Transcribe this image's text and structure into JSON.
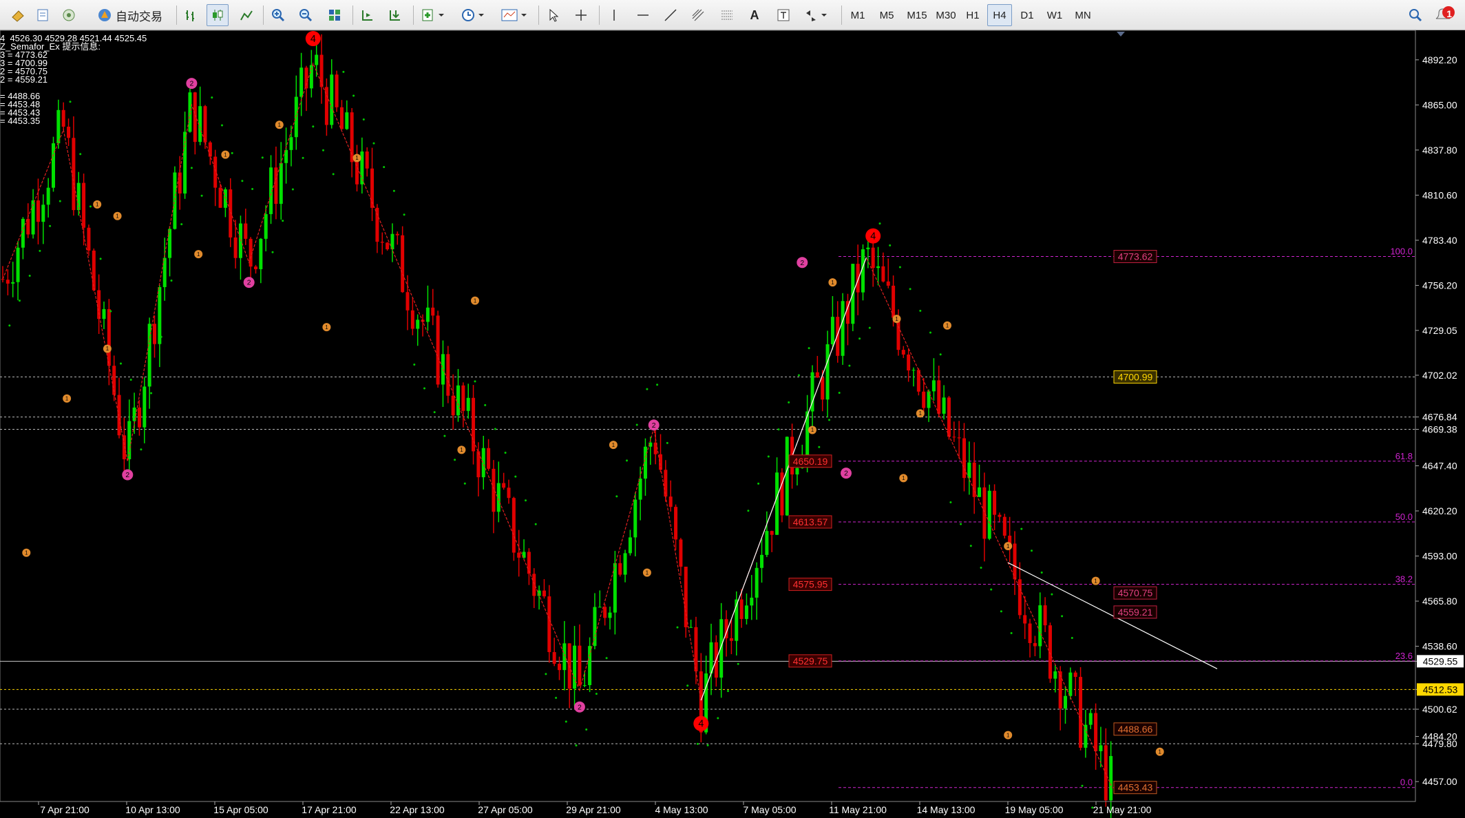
{
  "toolbar": {
    "auto_trade_label": "自动交易",
    "timeframes": [
      "M1",
      "M5",
      "M15",
      "M30",
      "H1",
      "H4",
      "D1",
      "W1",
      "MN"
    ],
    "active_timeframe": "H4",
    "notification_count": "1"
  },
  "info": {
    "ohlc": "4  4526.30 4529.28 4521.44 4525.45",
    "indicator_title": "Z_Semafor_Ex 提示信息:",
    "lines": [
      "3 = 4773.62",
      "3 = 4700.99",
      "2 = 4570.75",
      "2 = 4559.21",
      "",
      "= 4488.66",
      "= 4453.48",
      "= 4453.43",
      "= 4453.35"
    ]
  },
  "colors": {
    "bull": "#00e000",
    "bear": "#e00000",
    "grid": "#ffffff",
    "fib": "#d024d0",
    "semafor_small": "#e08a2c",
    "semafor_mid": "#e040a0",
    "semafor_big": "#ff0000",
    "current_price": "#ffffff",
    "highlight_price": "#ffd800"
  },
  "chart_data": {
    "type": "candlestick",
    "symbol_timeframe": "H4",
    "price_axis": [
      "4892.20",
      "4865.00",
      "4837.80",
      "4810.60",
      "4783.40",
      "4756.20",
      "4729.05",
      "4702.02",
      "4676.84",
      "4669.38",
      "4647.40",
      "4620.20",
      "4593.00",
      "4565.80",
      "4538.60",
      "4529.55",
      "4512.53",
      "4500.62",
      "4484.20",
      "4479.80",
      "4457.00"
    ],
    "ylim": [
      4445,
      4910
    ],
    "time_axis": [
      "7 Apr 21:00",
      "10 Apr 13:00",
      "15 Apr 05:00",
      "17 Apr 21:00",
      "22 Apr 13:00",
      "27 Apr 05:00",
      "29 Apr 21:00",
      "4 May 13:00",
      "7 May 05:00",
      "11 May 21:00",
      "14 May 13:00",
      "19 May 05:00",
      "21 May 21:00"
    ],
    "current_price": "4529.55",
    "highlight_price": "4512.53",
    "fib_levels": [
      {
        "label": "100.0",
        "price": 4773.62
      },
      {
        "label": "61.8",
        "price": 4650.19
      },
      {
        "label": "50.0",
        "price": 4613.57
      },
      {
        "label": "38.2",
        "price": 4575.95
      },
      {
        "label": "23.6",
        "price": 4529.75
      },
      {
        "label": "0.0",
        "price": 4453.43
      }
    ],
    "price_tags": [
      {
        "label": "4773.62",
        "price": 4773.62
      },
      {
        "label": "4700.99",
        "price": 4700.99
      },
      {
        "label": "4570.75",
        "price": 4570.75
      },
      {
        "label": "4559.21",
        "price": 4559.21
      },
      {
        "label": "4488.66",
        "price": 4488.66
      },
      {
        "label": "4453.43",
        "price": 4453.43
      }
    ],
    "fib_tags": [
      {
        "label": "4650.19",
        "price": 4650.19
      },
      {
        "label": "4613.57",
        "price": 4613.57
      },
      {
        "label": "4575.95",
        "price": 4575.95
      },
      {
        "label": "4529.75",
        "price": 4529.75
      }
    ],
    "h_lines": [
      4700.99,
      4676.84,
      4669.38,
      4529.55,
      4512.53,
      4500.62,
      4479.8
    ],
    "semafor_labels": {
      "small": "1",
      "mid": "2",
      "big": "4"
    },
    "zigzag": [
      {
        "t": 0,
        "p": 4760
      },
      {
        "t": 18,
        "p": 4850
      },
      {
        "t": 37,
        "p": 4650
      },
      {
        "t": 56,
        "p": 4865
      },
      {
        "t": 73,
        "p": 4770
      },
      {
        "t": 92,
        "p": 4890
      },
      {
        "t": 171,
        "p": 4512
      },
      {
        "t": 193,
        "p": 4670
      },
      {
        "t": 207,
        "p": 4506
      },
      {
        "t": 256,
        "p": 4773
      },
      {
        "t": 329,
        "p": 4453
      }
    ],
    "semafor_points": [
      {
        "t": 92,
        "p": 4905,
        "k": "big"
      },
      {
        "t": 258,
        "p": 4786,
        "k": "big"
      },
      {
        "t": 207,
        "p": 4492,
        "k": "big"
      },
      {
        "t": 56,
        "p": 4878,
        "k": "mid"
      },
      {
        "t": 37,
        "p": 4642,
        "k": "mid"
      },
      {
        "t": 73,
        "p": 4758,
        "k": "mid"
      },
      {
        "t": 171,
        "p": 4502,
        "k": "mid"
      },
      {
        "t": 193,
        "p": 4672,
        "k": "mid"
      },
      {
        "t": 237,
        "p": 4770,
        "k": "mid"
      },
      {
        "t": 250,
        "p": 4643,
        "k": "mid"
      },
      {
        "t": 7,
        "p": 4595,
        "k": "small"
      },
      {
        "t": 28,
        "p": 4805,
        "k": "small"
      },
      {
        "t": 34,
        "p": 4798,
        "k": "small"
      },
      {
        "t": 19,
        "p": 4688,
        "k": "small"
      },
      {
        "t": 31,
        "p": 4718,
        "k": "small"
      },
      {
        "t": 58,
        "p": 4775,
        "k": "small"
      },
      {
        "t": 66,
        "p": 4835,
        "k": "small"
      },
      {
        "t": 82,
        "p": 4853,
        "k": "small"
      },
      {
        "t": 96,
        "p": 4731,
        "k": "small"
      },
      {
        "t": 105,
        "p": 4833,
        "k": "small"
      },
      {
        "t": 140,
        "p": 4747,
        "k": "small"
      },
      {
        "t": 136,
        "p": 4657,
        "k": "small"
      },
      {
        "t": 181,
        "p": 4660,
        "k": "small"
      },
      {
        "t": 191,
        "p": 4583,
        "k": "small"
      },
      {
        "t": 240,
        "p": 4669,
        "k": "small"
      },
      {
        "t": 246,
        "p": 4758,
        "k": "small"
      },
      {
        "t": 265,
        "p": 4736,
        "k": "small"
      },
      {
        "t": 267,
        "p": 4640,
        "k": "small"
      },
      {
        "t": 272,
        "p": 4679,
        "k": "small"
      },
      {
        "t": 280,
        "p": 4732,
        "k": "small"
      },
      {
        "t": 298,
        "p": 4599,
        "k": "small"
      },
      {
        "t": 324,
        "p": 4578,
        "k": "small"
      },
      {
        "t": 298,
        "p": 4485,
        "k": "small"
      },
      {
        "t": 343,
        "p": 4475,
        "k": "small"
      }
    ]
  }
}
